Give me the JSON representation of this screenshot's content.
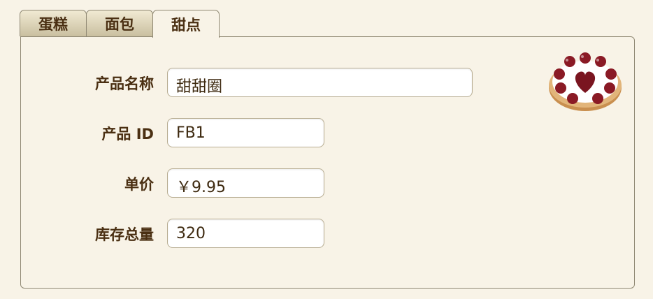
{
  "tabs": [
    {
      "label": "蛋糕",
      "active": false
    },
    {
      "label": "面包",
      "active": false
    },
    {
      "label": "甜点",
      "active": true
    }
  ],
  "form": {
    "name_label": "产品名称",
    "name_value": "甜甜圈",
    "id_label": "产品 ID",
    "id_value": "FB1",
    "price_label": "单价",
    "price_value": "￥9.95",
    "stock_label": "库存总量",
    "stock_value": "320"
  },
  "image": {
    "icon": "cherry-tart-icon",
    "colors": {
      "crust": "#d2a060",
      "cream": "#ffffff",
      "cherry": "#8a1a25"
    }
  }
}
